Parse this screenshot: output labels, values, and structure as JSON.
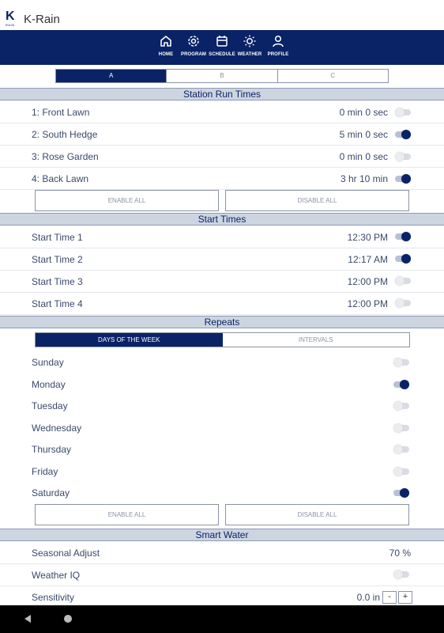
{
  "app": {
    "logo_letter": "K",
    "logo_sub": "RAIN",
    "title": "K-Rain"
  },
  "nav": [
    {
      "label": "HOME",
      "icon": "home-icon"
    },
    {
      "label": "PROGRAM",
      "icon": "gear-icon"
    },
    {
      "label": "SCHEDULE",
      "icon": "calendar-icon"
    },
    {
      "label": "WEATHER",
      "icon": "sun-icon"
    },
    {
      "label": "PROFILE",
      "icon": "person-icon"
    }
  ],
  "program_tabs": {
    "selected": "A",
    "items": [
      "A",
      "B",
      "C"
    ]
  },
  "station_run_times": {
    "header": "Station Run Times",
    "stations": [
      {
        "name": "1: Front Lawn",
        "time": "0 min 0 sec",
        "enabled": false
      },
      {
        "name": "2: South Hedge",
        "time": "5 min 0 sec",
        "enabled": true
      },
      {
        "name": "3: Rose Garden",
        "time": "0 min 0 sec",
        "enabled": false
      },
      {
        "name": "4: Back Lawn",
        "time": "3 hr 10 min",
        "enabled": true
      }
    ],
    "enable_all": "ENABLE ALL",
    "disable_all": "DISABLE ALL"
  },
  "start_times": {
    "header": "Start Times",
    "items": [
      {
        "name": "Start Time 1",
        "time": "12:30 PM",
        "enabled": true
      },
      {
        "name": "Start Time 2",
        "time": "12:17 AM",
        "enabled": true
      },
      {
        "name": "Start Time 3",
        "time": "12:00 PM",
        "enabled": false
      },
      {
        "name": "Start Time 4",
        "time": "12:00 PM",
        "enabled": false
      }
    ]
  },
  "repeats": {
    "header": "Repeats",
    "mode_tabs": [
      "DAYS OF THE WEEK",
      "INTERVALS"
    ],
    "selected_mode": "DAYS OF THE WEEK",
    "days": [
      {
        "name": "Sunday",
        "enabled": false
      },
      {
        "name": "Monday",
        "enabled": true
      },
      {
        "name": "Tuesday",
        "enabled": false
      },
      {
        "name": "Wednesday",
        "enabled": false
      },
      {
        "name": "Thursday",
        "enabled": false
      },
      {
        "name": "Friday",
        "enabled": false
      },
      {
        "name": "Saturday",
        "enabled": true
      }
    ],
    "enable_all": "ENABLE ALL",
    "disable_all": "DISABLE ALL"
  },
  "smart_water": {
    "header": "Smart Water",
    "seasonal_adjust": {
      "label": "Seasonal Adjust",
      "value": "70 %"
    },
    "weather_iq": {
      "label": "Weather IQ",
      "enabled": false
    },
    "sensitivity": {
      "label": "Sensitivity",
      "value": "0.0 in",
      "minus": "-",
      "plus": "+"
    }
  },
  "colors": {
    "brand": "#0a2366",
    "section_bg": "#cdd5e1",
    "text": "#3a4a6b"
  }
}
